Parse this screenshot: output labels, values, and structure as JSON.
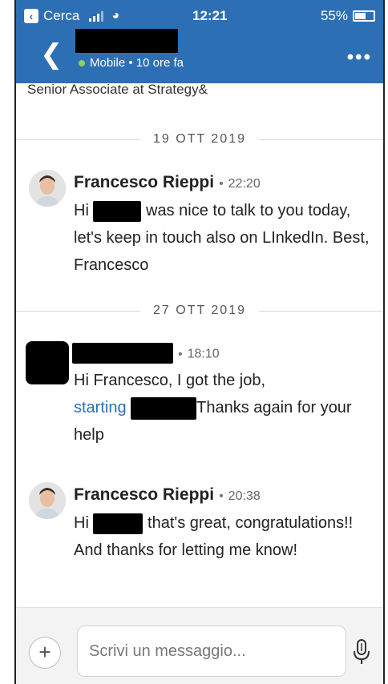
{
  "status_bar": {
    "back_app_label": "Cerca",
    "time": "12:21",
    "battery": "55%"
  },
  "header": {
    "presence": "Mobile • 10 ore fa",
    "headline": "Senior Associate at Strategy&"
  },
  "messages": [
    {
      "date_divider": "19 OTT 2019",
      "sender": "Francesco Rieppi",
      "time": "22:20",
      "text_before": "Hi",
      "text_after": "was nice to talk to you today, let's keep in touch also on LInkedIn. Best, Francesco"
    },
    {
      "date_divider": "27 OTT 2019",
      "time": "18:10",
      "line1": "Hi Francesco, I got the job,",
      "link_text": "starting",
      "text_after": "Thanks again for your help"
    },
    {
      "sender": "Francesco Rieppi",
      "time": "20:38",
      "text_before": "Hi",
      "text_after": "that's great, congratulations!! And thanks for letting me know!"
    }
  ],
  "composer": {
    "placeholder": "Scrivi un messaggio..."
  },
  "colors": {
    "accent": "#2d6fb4",
    "presence": "#8bd55a"
  },
  "icons": [
    "back-icon",
    "more-icon",
    "plus-icon",
    "mic-icon",
    "wifi-icon",
    "signal-icon",
    "battery-icon"
  ]
}
